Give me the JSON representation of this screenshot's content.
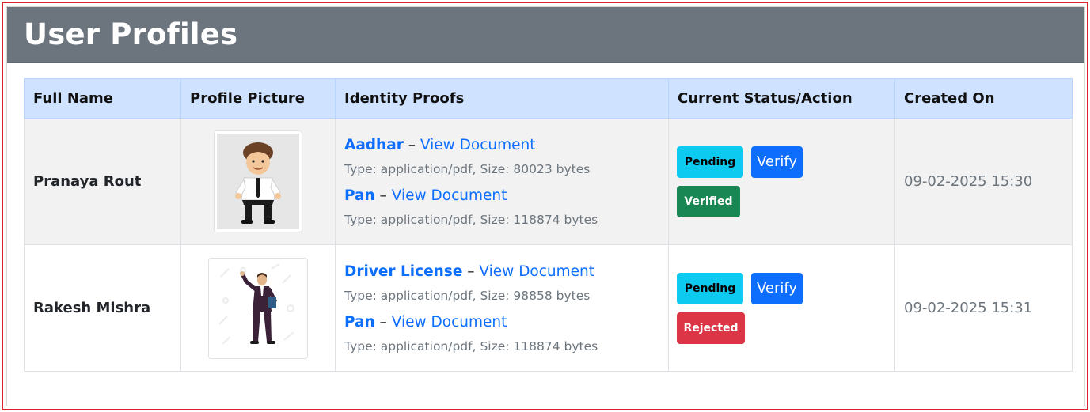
{
  "page": {
    "title": "User Profiles"
  },
  "table": {
    "headers": [
      "Full Name",
      "Profile Picture",
      "Identity Proofs",
      "Current Status/Action",
      "Created On"
    ],
    "rows": [
      {
        "full_name": "Pranaya Rout",
        "avatar_icon": "cartoon-businessman-avatar",
        "proofs": [
          {
            "type": "Aadhar",
            "dash": "–",
            "link": "View Document",
            "meta": "Type: application/pdf, Size: 80023 bytes"
          },
          {
            "type": "Pan",
            "dash": "–",
            "link": "View Document",
            "meta": "Type: application/pdf, Size: 118874 bytes"
          }
        ],
        "status_label": "Pending",
        "action_label": "Verify",
        "result_label": "Verified",
        "created_on": "09-02-2025 15:30"
      },
      {
        "full_name": "Rakesh Mishra",
        "avatar_icon": "businessman-presenter-avatar",
        "proofs": [
          {
            "type": "Driver License",
            "dash": "–",
            "link": "View Document",
            "meta": "Type: application/pdf, Size: 98858 bytes"
          },
          {
            "type": "Pan",
            "dash": "–",
            "link": "View Document",
            "meta": "Type: application/pdf, Size: 118874 bytes"
          }
        ],
        "status_label": "Pending",
        "action_label": "Verify",
        "result_label": "Rejected",
        "created_on": "09-02-2025 15:31"
      }
    ]
  },
  "colors": {
    "header_bg": "#6c757d",
    "table_head_bg": "#cfe2ff",
    "link_blue": "#0d6efd",
    "pending": "#0dcaf0",
    "verified": "#198754",
    "rejected": "#dc3545",
    "frame_border": "#d9232e"
  }
}
